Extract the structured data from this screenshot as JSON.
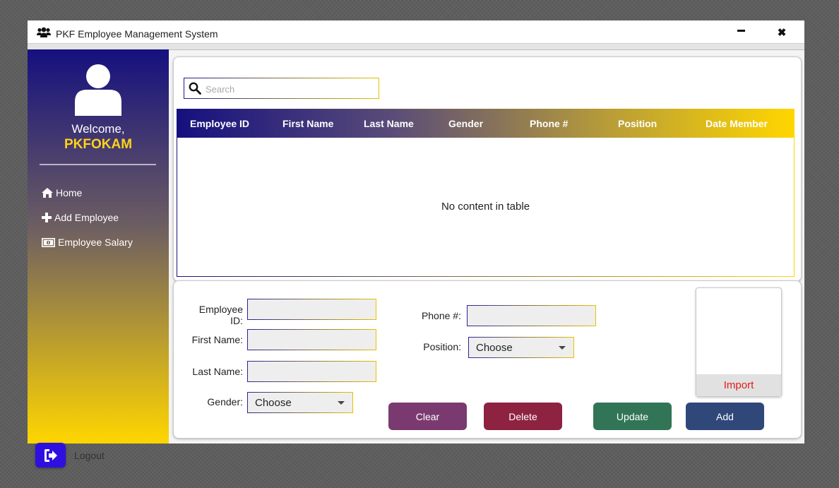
{
  "window": {
    "title": "PKF Employee Management System"
  },
  "sidebar": {
    "welcome": "Welcome,",
    "username": "PKFOKAM",
    "items": [
      {
        "label": "Home",
        "icon": "home-icon"
      },
      {
        "label": "Add Employee",
        "icon": "plus-icon"
      },
      {
        "label": "Employee Salary",
        "icon": "money-icon"
      }
    ],
    "logout": "Logout"
  },
  "search": {
    "placeholder": "Search",
    "value": ""
  },
  "table": {
    "columns": [
      "Employee ID",
      "First Name",
      "Last Name",
      "Gender",
      "Phone #",
      "Position",
      "Date Member"
    ],
    "empty_text": "No content in table"
  },
  "form": {
    "employee_id_label": "Employee ID:",
    "first_name_label": "First Name:",
    "last_name_label": "Last Name:",
    "gender_label": "Gender:",
    "gender_value": "Choose",
    "phone_label": "Phone #:",
    "position_label": "Position:",
    "position_value": "Choose",
    "employee_id_value": "",
    "first_name_value": "",
    "last_name_value": "",
    "phone_value": ""
  },
  "actions": {
    "import": "Import",
    "clear": "Clear",
    "delete": "Delete",
    "update": "Update",
    "add": "Add"
  },
  "colors": {
    "sidebar_top": "#15107f",
    "sidebar_bottom": "#ffd600",
    "username": "#ffd21a",
    "logout_button": "#2d10e0",
    "import_text": "#e31b1b",
    "clear_button": "#7b3a6f",
    "delete_button": "#8e2241",
    "update_button": "#317556",
    "add_button": "#30477a"
  }
}
